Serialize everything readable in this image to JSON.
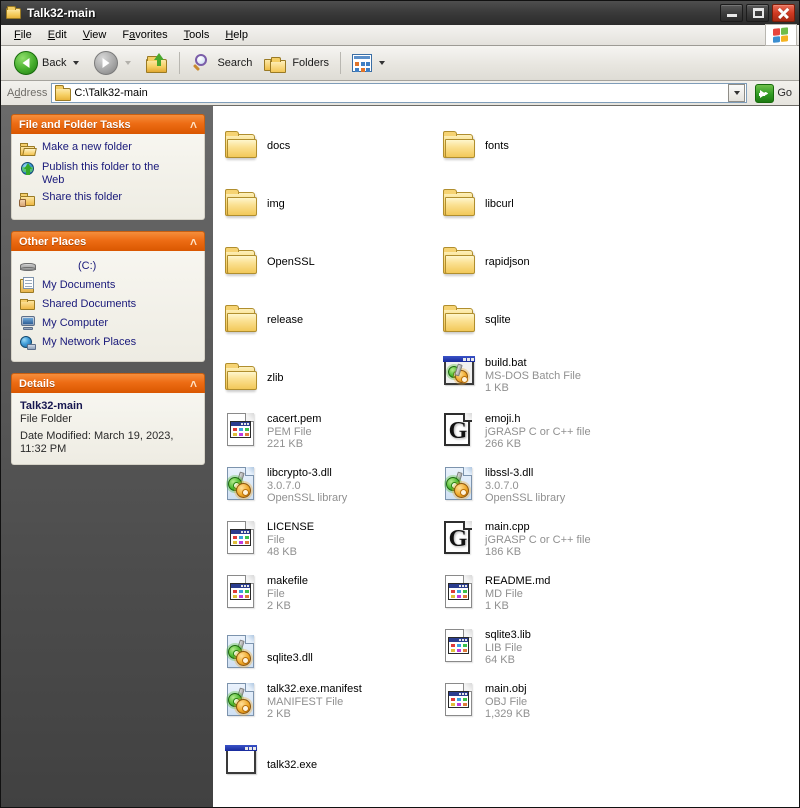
{
  "window": {
    "title": "Talk32-main",
    "controls": {
      "minimize": "Minimize",
      "maximize": "Maximize",
      "close": "Close"
    }
  },
  "menu": {
    "items": [
      {
        "label": "File",
        "accel": "F"
      },
      {
        "label": "Edit",
        "accel": "E"
      },
      {
        "label": "View",
        "accel": "V"
      },
      {
        "label": "Favorites",
        "accel": "a"
      },
      {
        "label": "Tools",
        "accel": "T"
      },
      {
        "label": "Help",
        "accel": "H"
      }
    ]
  },
  "toolbar": {
    "back_label": "Back",
    "search_label": "Search",
    "folders_label": "Folders",
    "forward_label": "Forward",
    "up_label": "Up",
    "views_label": "Views"
  },
  "address": {
    "label": "Address",
    "value": "C:\\Talk32-main",
    "go_label": "Go"
  },
  "sidebar": {
    "panels": [
      {
        "title": "File and Folder Tasks",
        "items": [
          {
            "label": "Make a new folder",
            "icon": "new-folder-icon"
          },
          {
            "label": "Publish this folder to the Web",
            "icon": "publish-web-icon"
          },
          {
            "label": "Share this folder",
            "icon": "share-folder-icon"
          }
        ]
      },
      {
        "title": "Other Places",
        "items": [
          {
            "label": "(C:)",
            "icon": "drive-icon"
          },
          {
            "label": "My Documents",
            "icon": "my-documents-icon"
          },
          {
            "label": "Shared Documents",
            "icon": "shared-documents-icon"
          },
          {
            "label": "My Computer",
            "icon": "my-computer-icon"
          },
          {
            "label": "My Network Places",
            "icon": "network-places-icon"
          }
        ]
      },
      {
        "title": "Details",
        "name": "Talk32-main",
        "type": "File Folder",
        "date": "Date Modified: March 19, 2023, 11:32 PM"
      }
    ]
  },
  "files": [
    {
      "name": "docs",
      "type": "",
      "size": "",
      "icon": "folder-icon"
    },
    {
      "name": "fonts",
      "type": "",
      "size": "",
      "icon": "folder-icon"
    },
    {
      "name": "img",
      "type": "",
      "size": "",
      "icon": "folder-icon"
    },
    {
      "name": "libcurl",
      "type": "",
      "size": "",
      "icon": "folder-icon"
    },
    {
      "name": "OpenSSL",
      "type": "",
      "size": "",
      "icon": "folder-icon"
    },
    {
      "name": "rapidjson",
      "type": "",
      "size": "",
      "icon": "folder-icon"
    },
    {
      "name": "release",
      "type": "",
      "size": "",
      "icon": "folder-icon"
    },
    {
      "name": "sqlite",
      "type": "",
      "size": "",
      "icon": "folder-icon"
    },
    {
      "name": "zlib",
      "type": "",
      "size": "",
      "icon": "folder-icon"
    },
    {
      "name": "build.bat",
      "type": "MS-DOS Batch File",
      "size": "1 KB",
      "icon": "batch-file-icon"
    },
    {
      "name": "cacert.pem",
      "type": "PEM File",
      "size": "221 KB",
      "icon": "generic-file-icon"
    },
    {
      "name": "emoji.h",
      "type": "jGRASP C or C++ file",
      "size": "266 KB",
      "icon": "jgrasp-file-icon"
    },
    {
      "name": "libcrypto-3.dll",
      "type": "3.0.7.0",
      "size": "OpenSSL library",
      "icon": "dll-file-icon"
    },
    {
      "name": "libssl-3.dll",
      "type": "3.0.7.0",
      "size": "OpenSSL library",
      "icon": "dll-file-icon"
    },
    {
      "name": "LICENSE",
      "type": "File",
      "size": "48 KB",
      "icon": "generic-file-icon"
    },
    {
      "name": "main.cpp",
      "type": "jGRASP C or C++ file",
      "size": "186 KB",
      "icon": "jgrasp-file-icon"
    },
    {
      "name": "makefile",
      "type": "File",
      "size": "2 KB",
      "icon": "generic-file-icon"
    },
    {
      "name": "README.md",
      "type": "MD File",
      "size": "1 KB",
      "icon": "generic-file-icon"
    },
    {
      "name": "sqlite3.dll",
      "type": "",
      "size": "",
      "icon": "dll-file-icon"
    },
    {
      "name": "sqlite3.lib",
      "type": "LIB File",
      "size": "64 KB",
      "icon": "generic-file-icon"
    },
    {
      "name": "talk32.exe.manifest",
      "type": "MANIFEST File",
      "size": "2 KB",
      "icon": "dll-file-icon"
    },
    {
      "name": "main.obj",
      "type": "OBJ File",
      "size": "1,329 KB",
      "icon": "generic-file-icon"
    },
    {
      "name": "talk32.exe",
      "type": "",
      "size": "",
      "icon": "exe-file-icon"
    }
  ],
  "colors": {
    "panel_header": "#ed6c14",
    "link_text": "#19197a",
    "subtext": "#909090",
    "frame": "#3c3c3c"
  }
}
